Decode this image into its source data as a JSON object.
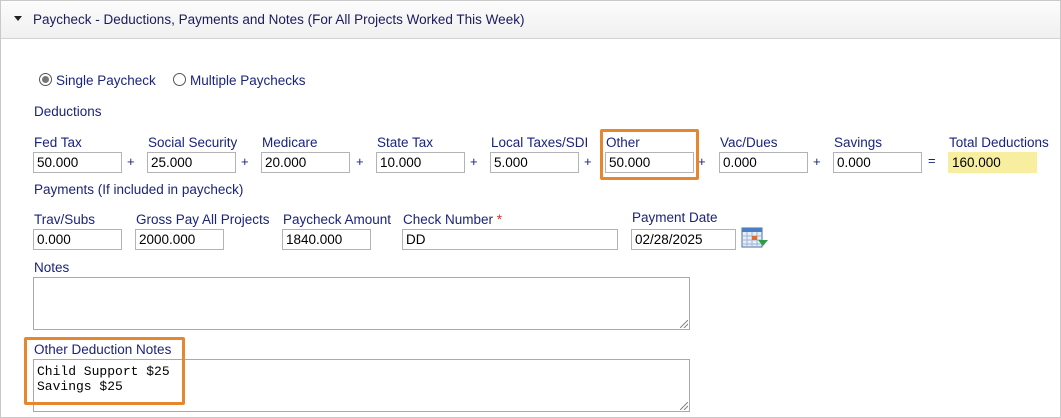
{
  "panel": {
    "title": "Paycheck - Deductions, Payments and Notes (For All Projects Worked This Week)",
    "caret_icon": "caret-down-icon"
  },
  "paycheck_mode": {
    "options": [
      {
        "label": "Single Paycheck",
        "selected": true
      },
      {
        "label": "Multiple Paychecks",
        "selected": false
      }
    ]
  },
  "deductions": {
    "section_label": "Deductions",
    "fields": [
      {
        "label": "Fed Tax",
        "value": "50.000"
      },
      {
        "label": "Social Security",
        "value": "25.000"
      },
      {
        "label": "Medicare",
        "value": "20.000"
      },
      {
        "label": "State Tax",
        "value": "10.000"
      },
      {
        "label": "Local Taxes/SDI",
        "value": "5.000"
      },
      {
        "label": "Other",
        "value": "50.000"
      },
      {
        "label": "Vac/Dues",
        "value": "0.000"
      },
      {
        "label": "Savings",
        "value": "0.000"
      }
    ],
    "plus": "+",
    "equals": "=",
    "total": {
      "label": "Total Deductions",
      "value": "160.000"
    }
  },
  "payments": {
    "section_label": "Payments (If included in paycheck)",
    "trav_subs": {
      "label": "Trav/Subs",
      "value": "0.000"
    },
    "gross_pay": {
      "label": "Gross Pay All Projects",
      "value": "2000.000"
    },
    "paycheck_amount": {
      "label": "Paycheck Amount",
      "value": "1840.000"
    },
    "check_number": {
      "label": "Check Number",
      "required_marker": "*",
      "value": "DD"
    },
    "payment_date": {
      "label": "Payment Date",
      "value": "02/28/2025",
      "icon": "calendar-icon"
    }
  },
  "notes": {
    "label": "Notes",
    "value": ""
  },
  "other_deduction_notes": {
    "label": "Other Deduction Notes",
    "lines": [
      "Child Support $25",
      "Savings $25"
    ]
  },
  "colors": {
    "label_text": "#1a237e",
    "highlight": "#e6862d",
    "total_bg": "#f7ee9f"
  }
}
